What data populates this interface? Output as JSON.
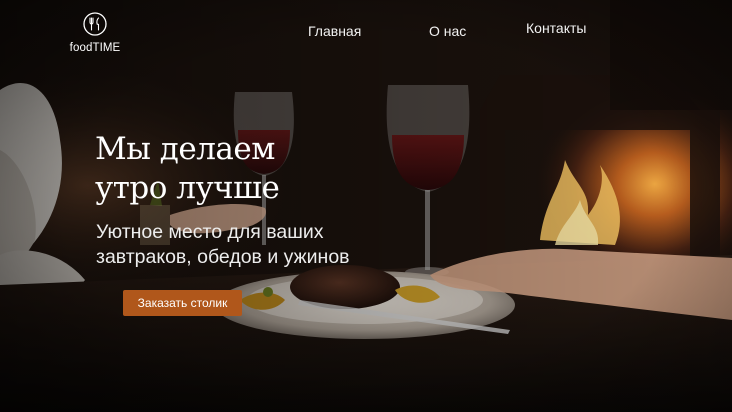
{
  "brand": {
    "name": "foodTIME",
    "icon": "fork-knife-logo-icon"
  },
  "nav": {
    "items": [
      {
        "label": "Главная"
      },
      {
        "label": "О нас"
      },
      {
        "label": "Контакты"
      }
    ]
  },
  "hero": {
    "title_lines": [
      "Мы делаем",
      "утро лучше"
    ],
    "subtitle_lines": [
      "Уютное место для ваших",
      "завтраков, обедов и ужинов"
    ],
    "cta_label": "Заказать столик",
    "background_image": "dimly-lit-restaurant-dinner-with-wine-glasses-steak-and-fireplace"
  },
  "colors": {
    "accent": "#b0571b",
    "text": "#ffffff",
    "background": "#0d0907"
  }
}
